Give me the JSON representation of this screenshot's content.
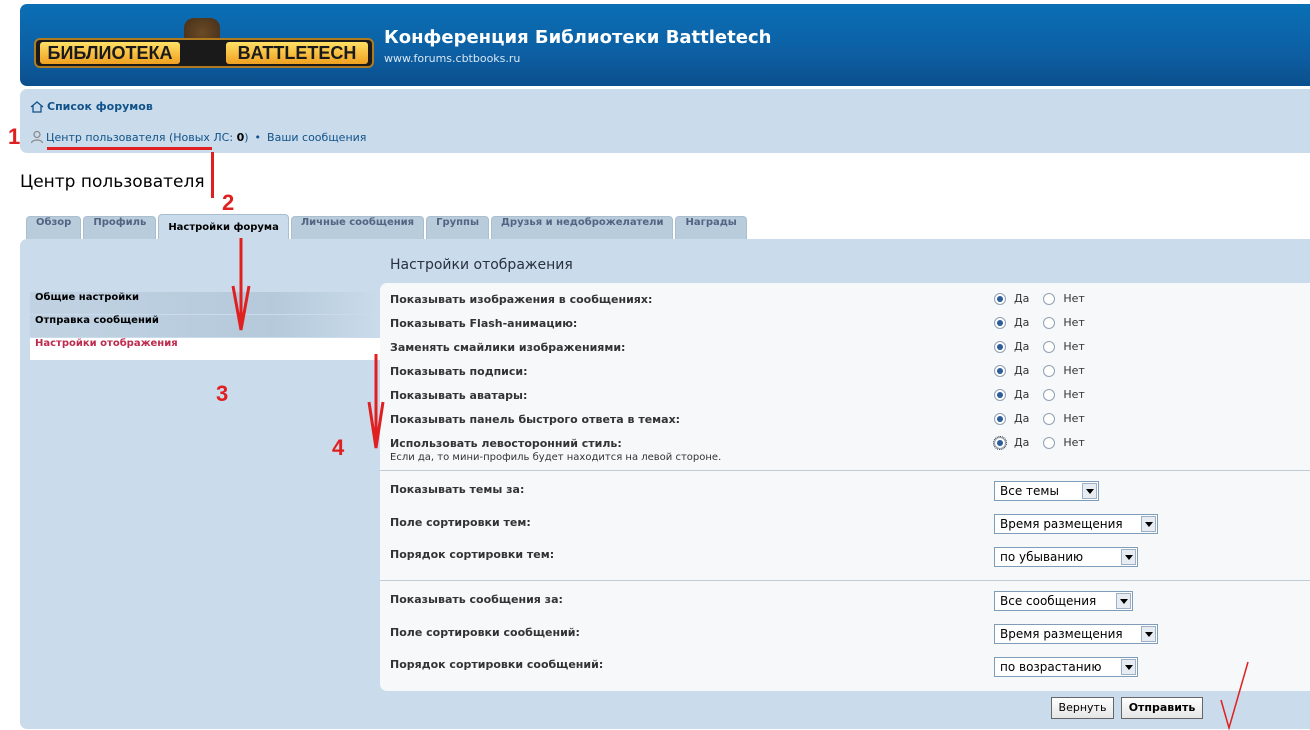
{
  "header": {
    "logo_left": "БИБЛИОТЕКА",
    "logo_right": "BATTLETECH",
    "title": "Конференция Библиотеки Battletech",
    "url": "www.forums.cbtbooks.ru"
  },
  "nav": {
    "forum_list": "Список форумов",
    "ucp_text": "Центр пользователя (Новых ЛС: ",
    "ucp_count": "0",
    "ucp_close": ")",
    "separator": "•",
    "your_posts": "Ваши сообщения"
  },
  "page_title": "Центр пользователя",
  "tabs": [
    "Обзор",
    "Профиль",
    "Настройки форума",
    "Личные сообщения",
    "Группы",
    "Друзья и недоброжелатели",
    "Награды"
  ],
  "menu": [
    "Общие настройки",
    "Отправка сообщений",
    "Настройки отображения"
  ],
  "content_title": "Настройки отображения",
  "yes_label": "Да",
  "no_label": "Нет",
  "options": [
    {
      "label": "Показывать изображения в сообщениях:",
      "value": "Да"
    },
    {
      "label": "Показывать Flash-анимацию:",
      "value": "Да"
    },
    {
      "label": "Заменять смайлики изображениями:",
      "value": "Да"
    },
    {
      "label": "Показывать подписи:",
      "value": "Да"
    },
    {
      "label": "Показывать аватары:",
      "value": "Да"
    },
    {
      "label": "Показывать панель быстрого ответа в темах:",
      "value": "Да"
    },
    {
      "label": "Использовать левосторонний стиль:",
      "desc": "Если да, то мини-профиль будет находится на левой стороне.",
      "value": "Да"
    }
  ],
  "topic_selects": [
    {
      "label": "Показывать темы за:",
      "value": "Все темы"
    },
    {
      "label": "Поле сортировки тем:",
      "value": "Время размещения"
    },
    {
      "label": "Порядок сортировки тем:",
      "value": "по убыванию"
    }
  ],
  "post_selects": [
    {
      "label": "Показывать сообщения за:",
      "value": "Все сообщения"
    },
    {
      "label": "Поле сортировки сообщений:",
      "value": "Время размещения"
    },
    {
      "label": "Порядок сортировки сообщений:",
      "value": "по возрастанию"
    }
  ],
  "buttons": {
    "reset": "Вернуть",
    "submit": "Отправить"
  },
  "annotations": [
    "1",
    "2",
    "3",
    "4"
  ],
  "colors": {
    "header_blue": "#0d5fa3",
    "panel": "#cadceb",
    "annotation_red": "#e02020",
    "active_menu": "#bc2a4d"
  }
}
